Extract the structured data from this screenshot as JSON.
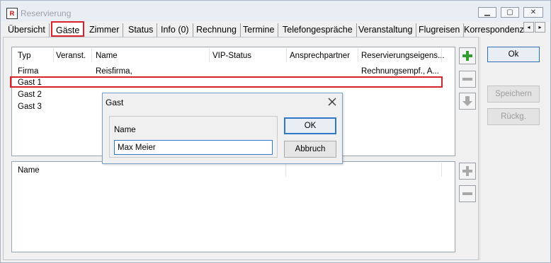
{
  "window": {
    "title": "Reservierung",
    "controls": [
      "minimize-icon",
      "maximize-icon",
      "close-icon"
    ]
  },
  "tabs": [
    {
      "label": "Übersicht",
      "active": false
    },
    {
      "label": "Gäste",
      "active": true
    },
    {
      "label": "Zimmer",
      "active": false
    },
    {
      "label": "Status",
      "active": false
    },
    {
      "label": "Info (0)",
      "active": false
    },
    {
      "label": "Rechnung",
      "active": false
    },
    {
      "label": "Termine",
      "active": false
    },
    {
      "label": "Telefongespräche",
      "active": false
    },
    {
      "label": "Veranstaltung",
      "active": false
    },
    {
      "label": "Flugreisen",
      "active": false
    },
    {
      "label": "Korrespondenz",
      "active": false
    }
  ],
  "tab_scroll": {
    "left": "◂",
    "right": "▸"
  },
  "guest_list": {
    "columns": [
      "Typ",
      "Veranst.",
      "Name",
      "VIP-Status",
      "Ansprechpartner",
      "Reservierungseigens..."
    ],
    "rows": [
      {
        "typ": "Firma",
        "veranst": "",
        "name": "Reisfirma,",
        "vip": "",
        "ansprech": "",
        "reserv": "Rechnungsempf., A..."
      },
      {
        "typ": "Gast 1",
        "veranst": "",
        "name": "",
        "vip": "",
        "ansprech": "",
        "reserv": ""
      },
      {
        "typ": "Gast 2",
        "veranst": "",
        "name": "",
        "vip": "",
        "ansprech": "",
        "reserv": ""
      },
      {
        "typ": "Gast 3",
        "veranst": "",
        "name": "",
        "vip": "",
        "ansprech": "",
        "reserv": ""
      }
    ],
    "selected_row": "Gast 1"
  },
  "detail_list": {
    "columns": [
      "Name"
    ]
  },
  "side_buttons": {
    "add": "add-icon",
    "remove": "minus-icon",
    "move_down": "arrow-down-icon",
    "add_detail": "add-icon",
    "remove_detail": "minus-icon"
  },
  "actions": {
    "ok": "Ok",
    "save": "Speichern",
    "undo": "Rückg."
  },
  "dialog": {
    "title": "Gast",
    "field_label": "Name",
    "field_value": "Max Meier",
    "ok": "OK",
    "cancel": "Abbruch"
  },
  "colors": {
    "highlight_red": "#d9232a",
    "add_green": "#2e9e2e",
    "focus_blue": "#2f79c6"
  }
}
